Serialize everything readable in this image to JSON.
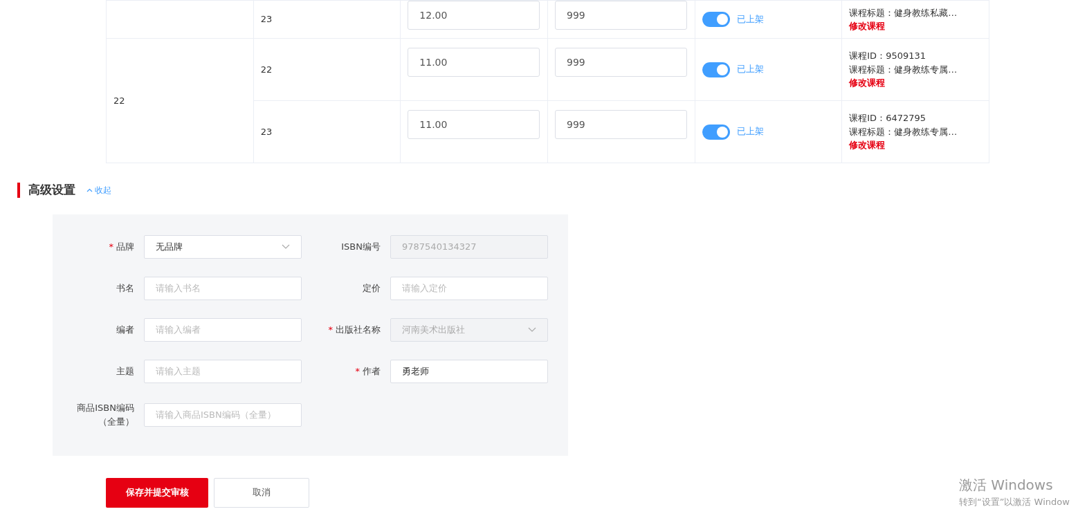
{
  "table": {
    "groups": [
      {
        "rows": [
          {
            "spec": "23",
            "price": "12.00",
            "stock": "999",
            "listed": true,
            "status_text": "已上架",
            "course_title": "课程标题：健身教练私藏…",
            "edit_link": "修改课程"
          }
        ]
      },
      {
        "label": "22",
        "rows": [
          {
            "spec": "22",
            "price": "11.00",
            "stock": "999",
            "listed": true,
            "status_text": "已上架",
            "course_id": "课程ID：9509131",
            "course_title": "课程标题：健身教练专属…",
            "edit_link": "修改课程"
          },
          {
            "spec": "23",
            "price": "11.00",
            "stock": "999",
            "listed": true,
            "status_text": "已上架",
            "course_id": "课程ID：6472795",
            "course_title": "课程标题：健身教练专属…",
            "edit_link": "修改课程"
          }
        ]
      }
    ]
  },
  "section": {
    "title": "高级设置",
    "toggle_link": "收起",
    "expanded": true
  },
  "form": {
    "fields": [
      {
        "kind": "select",
        "required_mark": "*",
        "label": "品牌",
        "value": "无品牌",
        "disabled": false
      },
      {
        "kind": "input",
        "label": "ISBN编号",
        "value": "9787540134327",
        "disabled": true
      },
      {
        "kind": "input",
        "label": "书名",
        "placeholder": "请输入书名",
        "disabled": false
      },
      {
        "kind": "input",
        "label": "定价",
        "placeholder": "请输入定价",
        "disabled": false
      },
      {
        "kind": "input",
        "label": "编者",
        "placeholder": "请输入编者",
        "disabled": false
      },
      {
        "kind": "select",
        "required_mark": "*",
        "label": "出版社名称",
        "value": "河南美术出版社",
        "disabled": true
      },
      {
        "kind": "input",
        "label": "主题",
        "placeholder": "请输入主题",
        "disabled": false
      },
      {
        "kind": "input",
        "required_mark": "*",
        "label": "作者",
        "value": "勇老师",
        "disabled": false
      },
      {
        "kind": "input",
        "label": "商品ISBN编码（全量）",
        "placeholder": "请输入商品ISBN编码（全量）",
        "disabled": false
      }
    ]
  },
  "buttons": [
    {
      "kind": "primary",
      "label": "保存并提交审核"
    },
    {
      "kind": "secondary",
      "label": "取消"
    }
  ],
  "os_notice": {
    "title": "激活 Windows",
    "subtitle": "转到“设置”以激活 Window"
  }
}
